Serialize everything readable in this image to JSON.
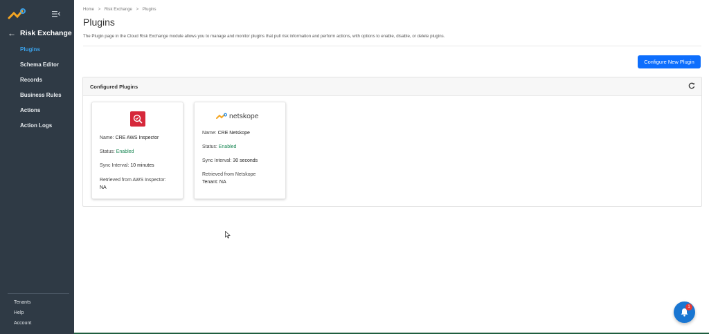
{
  "sidebar": {
    "module_title": "Risk Exchange",
    "items": [
      {
        "label": "Plugins",
        "active": true
      },
      {
        "label": "Schema Editor",
        "active": false
      },
      {
        "label": "Records",
        "active": false
      },
      {
        "label": "Business Rules",
        "active": false
      },
      {
        "label": "Actions",
        "active": false
      },
      {
        "label": "Action Logs",
        "active": false
      }
    ],
    "bottom_links": [
      "Tenants",
      "Help",
      "Account"
    ]
  },
  "breadcrumb": [
    "Home",
    ">",
    "Risk Exchange",
    ">",
    "Plugins"
  ],
  "page": {
    "title": "Plugins",
    "description": "The Plugin page in the Cloud Risk Exchange module allows you to manage and monitor plugins that pull risk information and perform actions, with options to enable, disable, or delete plugins.",
    "configure_button": "Configure New Plugin"
  },
  "panel": {
    "title": "Configured Plugins",
    "cards": [
      {
        "icon": "aws-inspector-icon",
        "name_label": "Name:",
        "name": "CRE AWS Inspector",
        "status_label": "Status:",
        "status": "Enabled",
        "sync_label": "Sync Interval:",
        "sync": "10 minutes",
        "retrieved_line1": "Retrieved from AWS Inspector:",
        "retrieved_line2": "NA"
      },
      {
        "icon": "netskope-logo",
        "logo_text": "netskope",
        "name_label": "Name:",
        "name": "CRE Netskope",
        "status_label": "Status:",
        "status": "Enabled",
        "sync_label": "Sync Interval:",
        "sync": "30 seconds",
        "retrieved_line1": "Retrieved from Netskope",
        "retrieved_line2": "Tenant: NA"
      }
    ]
  },
  "notifications": {
    "count": "1"
  },
  "colors": {
    "sidebar": "#2f3a45",
    "accent": "#0d6efd",
    "active_nav": "#3aa0e8",
    "enabled": "#198754"
  }
}
